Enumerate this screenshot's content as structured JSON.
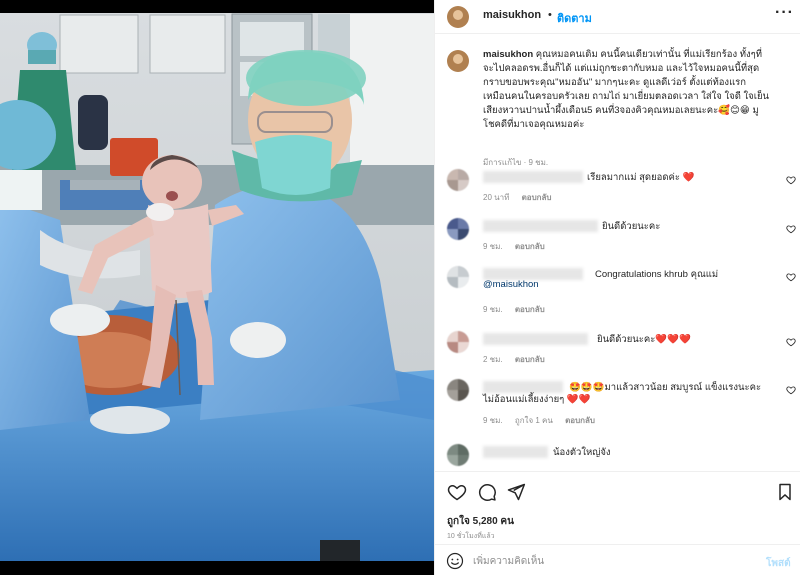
{
  "post": {
    "username": "maisukhon",
    "follow_label": "ติดตาม",
    "more_icon": "more-horizontal-icon",
    "caption": {
      "username": "maisukhon",
      "lines": [
        "คุณหมอคนเดิม คนนี้คนเดียวเท่านั้น ที่แม่เรียกร้อง ทั้งๆที่",
        "จะไปคลอดรพ.อื่นก็ได้ แต่แม่ถูกชะตากับหมอ และไว้ใจหมอคนนี้ที่สุด",
        "กราบขอบพระคุณ\"หมออัน\" มากๆนะคะ ดูแลดีเว่อร์ ตั้งแต่ท้องแรก",
        "เหมือนคนในครอบครัวเลย ถามไถ่ มาเยี่ยมตลอดเวลา ใส่ใจ ใจดี ใจเย็น",
        "เสียงหวานปานน้ำผึ้งเดือน5 คนที่3จองคิวคุณหมอเลยนะคะ🥰😊😁 มู",
        "โชคดีที่มาเจอคุณหมอค่ะ"
      ],
      "meta": "มีการแก้ไข · 9 ชม."
    },
    "comments": [
      {
        "lines": [
          "เรียลมากแม่ สุดยอดค่ะ ❤️"
        ],
        "time": "20 นาที",
        "likes": "",
        "reply": "ตอบกลับ"
      },
      {
        "lines": [
          "ยินดีด้วยนะคะ"
        ],
        "time": "9 ชม.",
        "likes": "",
        "reply": "ตอบกลับ"
      },
      {
        "lines": [
          "Congratulations khrub คุณแม่",
          "@maisukhon"
        ],
        "time": "9 ชม.",
        "likes": "",
        "reply": "ตอบกลับ"
      },
      {
        "lines": [
          "ยินดีด้วยนะคะ❤️❤️❤️"
        ],
        "time": "2 ชม.",
        "likes": "",
        "reply": "ตอบกลับ"
      },
      {
        "lines": [
          "🤩🤩🤩มาแล้วสาวน้อย สมบูรณ์ แข็งแรงนะคะ",
          "ไม่อ้อนแม่เลี้ยงง่ายๆ ❤️❤️"
        ],
        "time": "9 ชม.",
        "likes": "ถูกใจ 1 คน",
        "reply": "ตอบกลับ"
      },
      {
        "lines": [
          "น้องตัวใหญ่จัง"
        ],
        "time": "",
        "likes": "",
        "reply": ""
      }
    ],
    "actions": {
      "like_icon": "heart-icon",
      "comment_icon": "comment-icon",
      "share_icon": "send-icon",
      "save_icon": "bookmark-icon"
    },
    "likes_label": "ถูกใจ 5,280 คน",
    "time_ago": "10 ชั่วโมงที่แล้ว",
    "add_comment": {
      "emoji_icon": "smiley-icon",
      "placeholder": "เพิ่มความคิดเห็น",
      "post_label": "โพสต์"
    }
  },
  "colors": {
    "accent": "#0095f6",
    "post_disabled": "#b2dffc",
    "heart": "#ed4956",
    "muted": "#8e8e8e"
  }
}
